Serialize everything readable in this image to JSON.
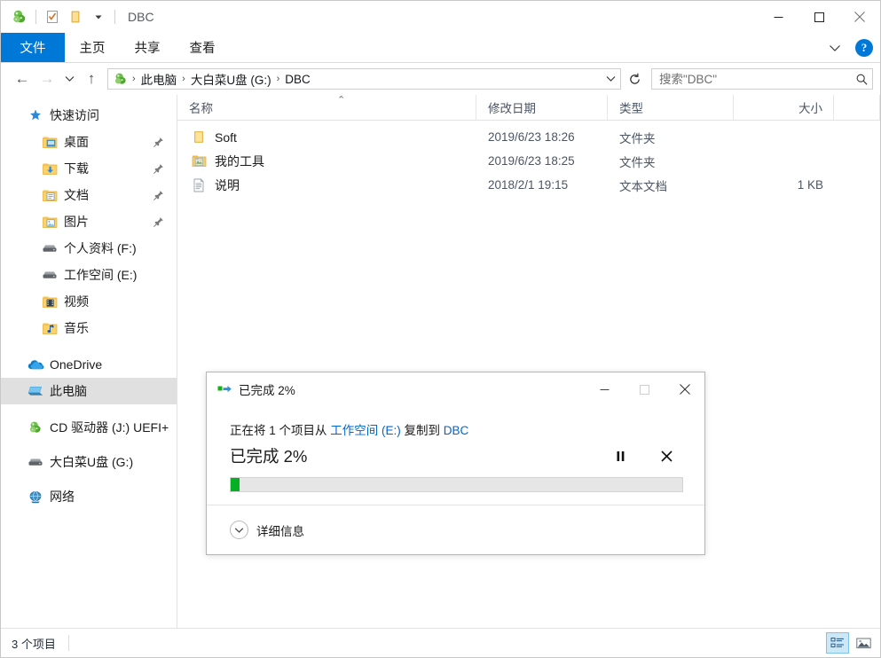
{
  "window": {
    "title": "DBC",
    "quick_access_icons": [
      "app-icon",
      "properties-icon",
      "new-folder-icon",
      "customize-dropdown-icon"
    ],
    "controls": {
      "minimize": "—",
      "maximize": "☐",
      "close": "✕"
    }
  },
  "ribbon": {
    "tabs": [
      {
        "label": "文件",
        "name": "tab-file",
        "active": true
      },
      {
        "label": "主页",
        "name": "tab-home",
        "active": false
      },
      {
        "label": "共享",
        "name": "tab-share",
        "active": false
      },
      {
        "label": "查看",
        "name": "tab-view",
        "active": false
      }
    ],
    "expand_icon": "chevron-down-icon",
    "help_label": "?"
  },
  "address": {
    "back": "←",
    "forward": "→",
    "recent": "⌄",
    "up": "↑",
    "breadcrumbs": [
      "此电脑",
      "大白菜U盘 (G:)",
      "DBC"
    ],
    "separator": "›",
    "refresh_icon": "refresh-icon"
  },
  "search": {
    "placeholder": "搜索\"DBC\"",
    "value": "",
    "icon": "search-icon"
  },
  "sidebar": {
    "items": [
      {
        "label": "快速访问",
        "icon": "star-pin-icon",
        "indent": 0,
        "pinned": false,
        "selected": false
      },
      {
        "label": "桌面",
        "icon": "desktop-folder-icon",
        "indent": 1,
        "pinned": true,
        "selected": false
      },
      {
        "label": "下载",
        "icon": "downloads-folder-icon",
        "indent": 1,
        "pinned": true,
        "selected": false
      },
      {
        "label": "文档",
        "icon": "documents-folder-icon",
        "indent": 1,
        "pinned": true,
        "selected": false
      },
      {
        "label": "图片",
        "icon": "pictures-folder-icon",
        "indent": 1,
        "pinned": true,
        "selected": false
      },
      {
        "label": "个人资料 (F:)",
        "icon": "drive-icon",
        "indent": 1,
        "pinned": false,
        "selected": false
      },
      {
        "label": "工作空间 (E:)",
        "icon": "drive-icon",
        "indent": 1,
        "pinned": false,
        "selected": false
      },
      {
        "label": "视频",
        "icon": "videos-folder-icon",
        "indent": 1,
        "pinned": false,
        "selected": false
      },
      {
        "label": "音乐",
        "icon": "music-folder-icon",
        "indent": 1,
        "pinned": false,
        "selected": false
      },
      {
        "label": "OneDrive",
        "icon": "onedrive-icon",
        "indent": 0,
        "pinned": false,
        "selected": false
      },
      {
        "label": "此电脑",
        "icon": "this-pc-icon",
        "indent": 0,
        "pinned": false,
        "selected": true
      },
      {
        "label": "CD 驱动器 (J:) UEFI+",
        "icon": "cd-drive-icon",
        "indent": 0,
        "pinned": false,
        "selected": false
      },
      {
        "label": "大白菜U盘 (G:)",
        "icon": "usb-drive-icon",
        "indent": 0,
        "pinned": false,
        "selected": false
      },
      {
        "label": "网络",
        "icon": "network-icon",
        "indent": 0,
        "pinned": false,
        "selected": false
      }
    ]
  },
  "filelist": {
    "columns": [
      {
        "label": "名称",
        "name": "column-name",
        "sorted": "asc"
      },
      {
        "label": "修改日期",
        "name": "column-date"
      },
      {
        "label": "类型",
        "name": "column-type"
      },
      {
        "label": "大小",
        "name": "column-size"
      }
    ],
    "sort_indicator": "⌃",
    "rows": [
      {
        "name": "Soft",
        "icon": "folder-icon",
        "date": "2019/6/23 18:26",
        "type": "文件夹",
        "size": ""
      },
      {
        "name": "我的工具",
        "icon": "custom-folder-icon",
        "date": "2019/6/23 18:25",
        "type": "文件夹",
        "size": ""
      },
      {
        "name": "说明",
        "icon": "text-file-icon",
        "date": "2018/2/1 19:15",
        "type": "文本文档",
        "size": "1 KB"
      }
    ]
  },
  "statusbar": {
    "item_count": "3 个项目",
    "views": [
      {
        "name": "details-view-button",
        "icon": "details-view-icon",
        "active": true
      },
      {
        "name": "large-icons-view-button",
        "icon": "large-icons-view-icon",
        "active": false
      }
    ]
  },
  "dialog": {
    "title": "已完成 2%",
    "icon": "copy-progress-icon",
    "controls": {
      "minimize": "—",
      "maximize": "☐",
      "close": "✕"
    },
    "message_prefix": "正在将 1 个项目从 ",
    "source": "工作空间 (E:)",
    "message_middle": " 复制到 ",
    "destination": "DBC",
    "percent_label": "已完成 2%",
    "progress_percent": 2,
    "progress_color": "#06b025",
    "pause_icon": "pause-icon",
    "cancel_icon": "cancel-icon",
    "details_label": "详细信息",
    "details_icon": "chevron-down-circle-icon"
  }
}
